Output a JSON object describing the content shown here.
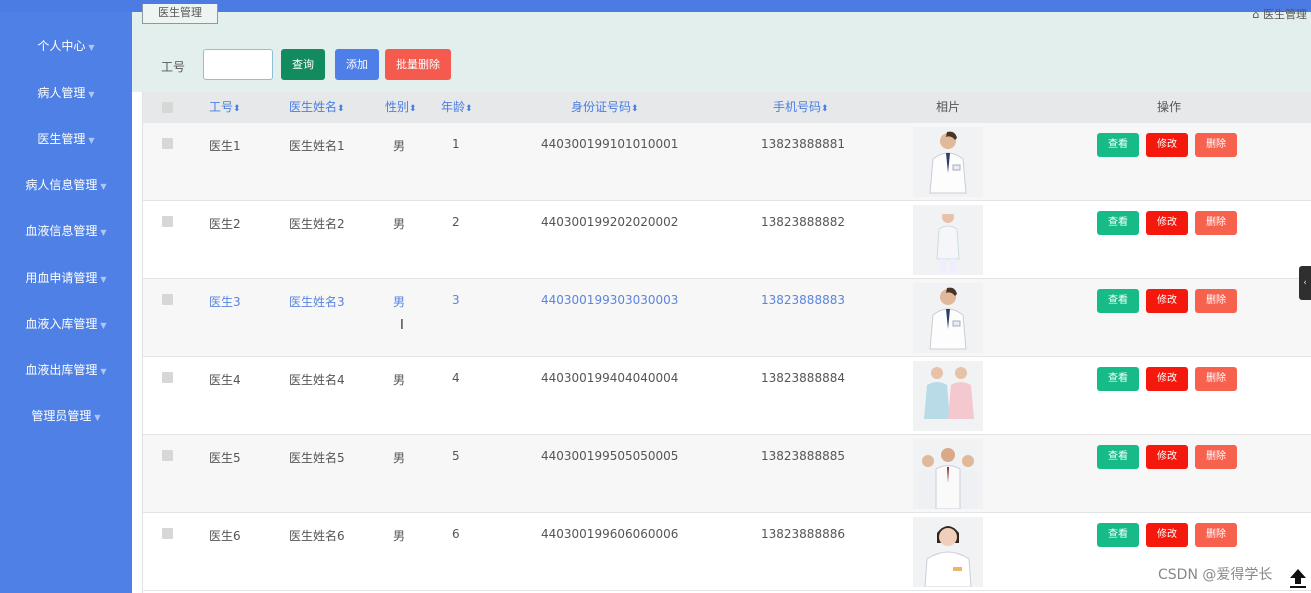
{
  "header": {
    "breadcrumb": "医生管理",
    "right_text": "医生管理"
  },
  "sidebar": {
    "items": [
      {
        "label": "个人中心"
      },
      {
        "label": "病人管理"
      },
      {
        "label": "医生管理"
      },
      {
        "label": "病人信息管理"
      },
      {
        "label": "血液信息管理"
      },
      {
        "label": "用血申请管理"
      },
      {
        "label": "血液入库管理"
      },
      {
        "label": "血液出库管理"
      },
      {
        "label": "管理员管理"
      }
    ]
  },
  "search": {
    "label": "工号",
    "input_value": "",
    "query_label": "查询",
    "add_label": "添加",
    "batch_delete_label": "批量删除"
  },
  "table": {
    "headers": {
      "id": "工号",
      "name": "医生姓名",
      "gender": "性别",
      "age": "年龄",
      "id_card": "身份证号码",
      "phone": "手机号码",
      "photo": "相片",
      "actions": "操作"
    },
    "rows": [
      {
        "id": "医生1",
        "name": "医生姓名1",
        "gender": "男",
        "age": "1",
        "id_card": "440300199101010001",
        "phone": "13823888881"
      },
      {
        "id": "医生2",
        "name": "医生姓名2",
        "gender": "男",
        "age": "2",
        "id_card": "440300199202020002",
        "phone": "13823888882"
      },
      {
        "id": "医生3",
        "name": "医生姓名3",
        "gender": "男",
        "age": "3",
        "id_card": "440300199303030003",
        "phone": "13823888883"
      },
      {
        "id": "医生4",
        "name": "医生姓名4",
        "gender": "男",
        "age": "4",
        "id_card": "440300199404040004",
        "phone": "13823888884"
      },
      {
        "id": "医生5",
        "name": "医生姓名5",
        "gender": "男",
        "age": "5",
        "id_card": "440300199505050005",
        "phone": "13823888885"
      },
      {
        "id": "医生6",
        "name": "医生姓名6",
        "gender": "男",
        "age": "6",
        "id_card": "440300199606060006",
        "phone": "13823888886"
      }
    ],
    "actions": {
      "view": "查看",
      "edit": "修改",
      "delete": "删除"
    }
  },
  "watermark": "CSDN @爱得学长",
  "colors": {
    "sidebar": "#4f80e6",
    "accent": "#4a7de3",
    "view": "#17bb88",
    "edit": "#f4190c",
    "delete": "#f7624f"
  },
  "icons": {
    "sort": "sort-icon",
    "upload": "upload-icon",
    "collapse": "chevron-left-icon"
  }
}
